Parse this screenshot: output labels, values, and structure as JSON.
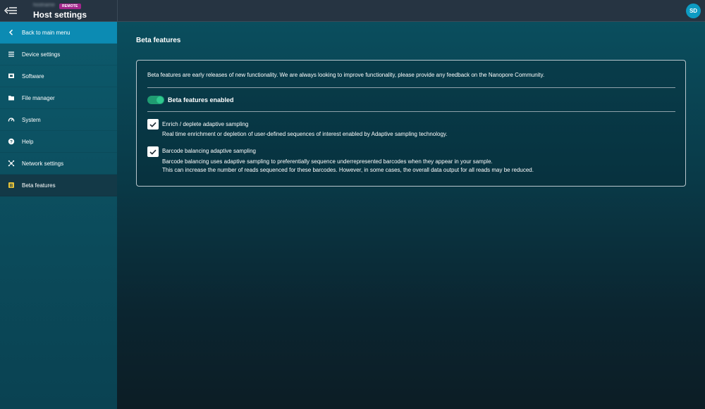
{
  "header": {
    "host_name": "hostname",
    "remote_badge": "REMOTE",
    "title": "Host settings",
    "avatar_initials": "SD"
  },
  "sidebar": {
    "items": [
      {
        "label": "Back to main menu",
        "icon": "chevron-left-icon"
      },
      {
        "label": "Device settings",
        "icon": "list-icon"
      },
      {
        "label": "Software",
        "icon": "software-icon"
      },
      {
        "label": "File manager",
        "icon": "folder-icon"
      },
      {
        "label": "System",
        "icon": "gauge-icon"
      },
      {
        "label": "Help",
        "icon": "help-icon"
      },
      {
        "label": "Network settings",
        "icon": "network-icon"
      },
      {
        "label": "Beta features",
        "icon": "beta-icon"
      }
    ],
    "active_item": "Beta features"
  },
  "main": {
    "page_title": "Beta features",
    "intro": "Beta features are early releases of new functionality. We are always looking to improve functionality, please provide any feedback on the Nanopore Community.",
    "toggle": {
      "label": "Beta features enabled",
      "enabled": true
    },
    "options": [
      {
        "title": "Enrich / deplete adaptive sampling",
        "description": [
          "Real time enrichment or depletion of user-defined sequences of interest enabled by Adaptive sampling technology."
        ],
        "checked": true
      },
      {
        "title": "Barcode balancing adaptive sampling",
        "description": [
          "Barcode balancing uses adaptive sampling to preferentially sequence underrepresented barcodes when they appear in your sample.",
          "This can increase the number of reads sequenced for these barcodes. However, in some cases, the overall data output for all reads may be reduced."
        ],
        "checked": true
      }
    ]
  },
  "colors": {
    "accent": "#0c8bb3",
    "toggle_on": "#2fc98f",
    "remote_badge": "#a3258c",
    "avatar": "#0d9bc3"
  }
}
